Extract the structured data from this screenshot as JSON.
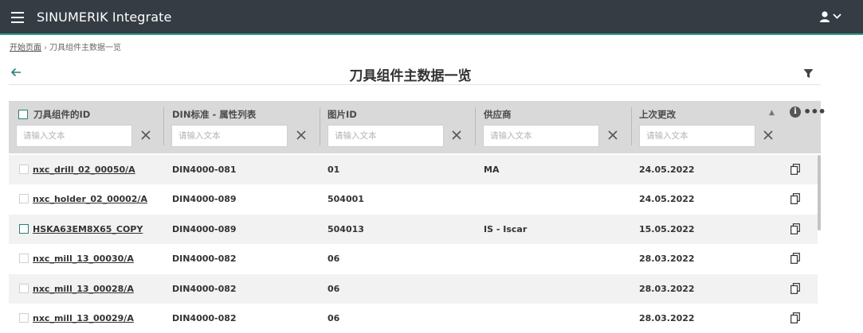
{
  "app": {
    "title": "SINUMERIK Integrate"
  },
  "breadcrumb": {
    "home": "开始页面",
    "current": "刀具组件主数据一览"
  },
  "page": {
    "title": "刀具组件主数据一览"
  },
  "table": {
    "columns": [
      "刀具组件的ID",
      "DIN标准 - 属性列表",
      "图片ID",
      "供应商",
      "上次更改"
    ],
    "filter_placeholder": "请输入文本",
    "rows": [
      {
        "id": "nxc_drill_02_00050/A",
        "din": "DIN4000-081",
        "image": "01",
        "supplier": "MA",
        "changed": "24.05.2022"
      },
      {
        "id": "nxc_holder_02_00002/A",
        "din": "DIN4000-089",
        "image": "504001",
        "supplier": "",
        "changed": "24.05.2022"
      },
      {
        "id": "HSKA63EM8X65_COPY",
        "din": "DIN4000-089",
        "image": "504013",
        "supplier": "IS - Iscar",
        "changed": "15.05.2022"
      },
      {
        "id": "nxc_mill_13_00030/A",
        "din": "DIN4000-082",
        "image": "06",
        "supplier": "",
        "changed": "28.03.2022"
      },
      {
        "id": "nxc_mill_13_00028/A",
        "din": "DIN4000-082",
        "image": "06",
        "supplier": "",
        "changed": "28.03.2022"
      },
      {
        "id": "nxc_mill_13_00029/A",
        "din": "DIN4000-082",
        "image": "06",
        "supplier": "",
        "changed": "28.03.2022"
      }
    ]
  },
  "colors": {
    "topbar": "#353c43",
    "accent": "#2d9c8a",
    "header_bg": "#d9d9d9"
  },
  "icons": [
    "menu-icon",
    "user-icon",
    "chevron-down-icon",
    "back-arrow-icon",
    "filter-icon",
    "info-icon",
    "more-icon",
    "clear-icon",
    "copy-icon"
  ]
}
